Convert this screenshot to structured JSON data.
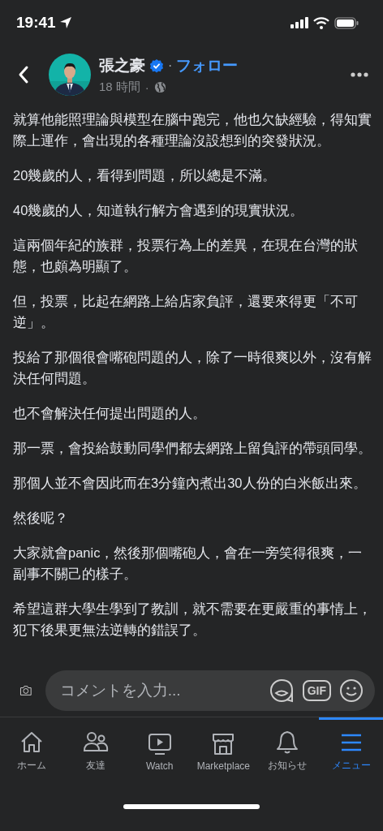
{
  "status_bar": {
    "time": "19:41"
  },
  "header": {
    "author": "張之豪",
    "verified": true,
    "follow": "フォロー",
    "time": "18 時間",
    "separator": "·"
  },
  "post": {
    "paragraphs": [
      "就算他能照理論與模型在腦中跑完，他也欠缺經驗，得知實際上運作，會出現的各種理論沒設想到的突發狀況。",
      "20幾歲的人，看得到問題，所以總是不滿。",
      "40幾歲的人，知道執行解方會遇到的現實狀況。",
      "這兩個年紀的族群，投票行為上的差異，在現在台灣的狀態，也頗為明顯了。",
      "但，投票，比起在網路上給店家負評，還要來得更「不可逆」。",
      "投給了那個很會嘴砲問題的人，除了一時很爽以外，沒有解決任何問題。",
      "也不會解決任何提出問題的人。",
      "那一票，會投給鼓動同學們都去網路上留負評的帶頭同學。",
      "那個人並不會因此而在3分鐘內煮出30人份的白米飯出來。",
      "然後呢？",
      "大家就會panic，然後那個嘴砲人，會在一旁笑得很爽，一副事不關己的樣子。",
      "希望這群大學生學到了教訓，就不需要在更嚴重的事情上，犯下後果更無法逆轉的錯誤了。"
    ]
  },
  "comment_bar": {
    "placeholder": "コメントを入力...",
    "gif": "GIF"
  },
  "tabs": [
    {
      "kind": "home",
      "label": "ホーム",
      "selected": false
    },
    {
      "kind": "friends",
      "label": "友達",
      "selected": false
    },
    {
      "kind": "watch",
      "label": "Watch",
      "selected": false
    },
    {
      "kind": "market",
      "label": "Marketplace",
      "selected": false
    },
    {
      "kind": "bell",
      "label": "お知らせ",
      "selected": false
    },
    {
      "kind": "menu",
      "label": "メニュー",
      "selected": true
    }
  ]
}
